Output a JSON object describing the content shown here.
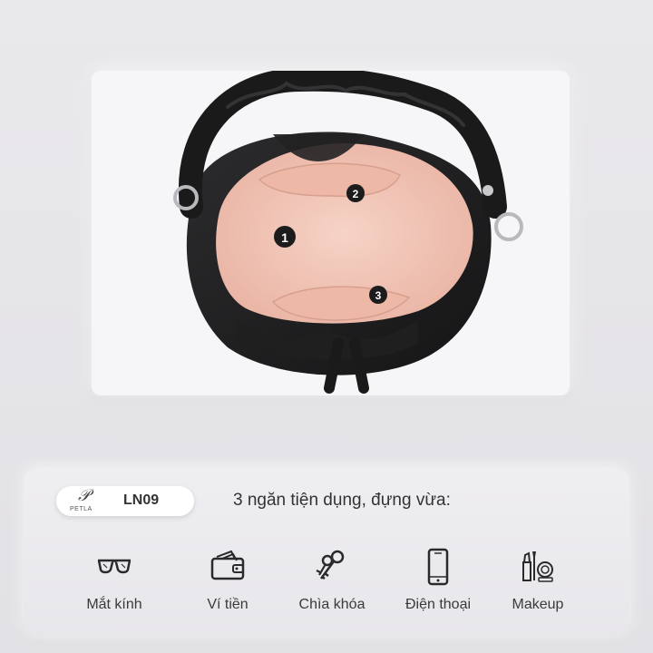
{
  "photo": {
    "markers": [
      "1",
      "2",
      "3"
    ]
  },
  "brand": {
    "logo_text": "PETLA",
    "model_code": "LN09"
  },
  "headline": "3 ngăn tiện dụng, đựng vừa:",
  "items": [
    {
      "label": "Mắt kính",
      "icon": "glasses-icon"
    },
    {
      "label": "Ví tiền",
      "icon": "wallet-icon"
    },
    {
      "label": "Chìa khóa",
      "icon": "keys-icon"
    },
    {
      "label": "Điện thoại",
      "icon": "phone-icon"
    },
    {
      "label": "Makeup",
      "icon": "makeup-icon"
    }
  ],
  "colors": {
    "background": "#e6e5e9",
    "bag": "#1e1e1f",
    "lining": "#f2c6b8",
    "text": "#333333"
  }
}
